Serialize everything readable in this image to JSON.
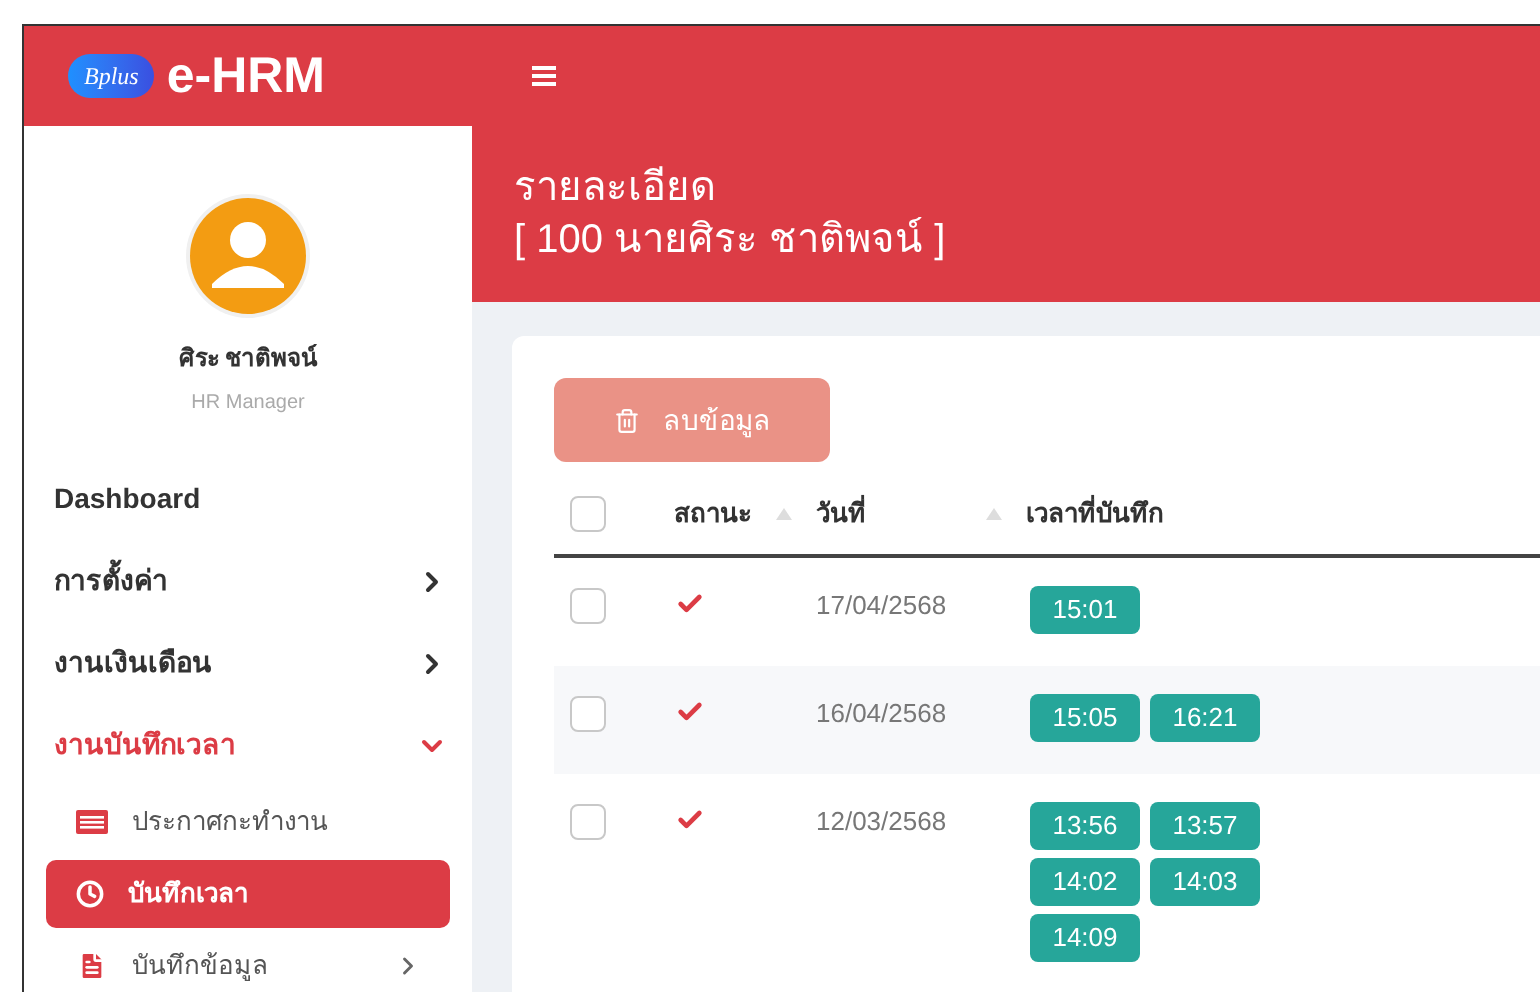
{
  "app": {
    "logo_text": "Bplus",
    "title": "e-HRM"
  },
  "user": {
    "name": "ศิระ ชาติพจน์",
    "role": "HR Manager"
  },
  "menu": [
    {
      "label": "Dashboard",
      "expandable": false,
      "expanded": false
    },
    {
      "label": "การตั้งค่า",
      "expandable": true,
      "expanded": false
    },
    {
      "label": "งานเงินเดือน",
      "expandable": true,
      "expanded": false
    },
    {
      "label": "งานบันทึกเวลา",
      "expandable": true,
      "expanded": true,
      "children": [
        {
          "label": "ประกาศกะทำงาน",
          "kind": "list",
          "selected": false,
          "expandable": false
        },
        {
          "label": "บันทึกเวลา",
          "kind": "clock",
          "selected": true,
          "expandable": false
        },
        {
          "label": "บันทึกข้อมูล",
          "kind": "file",
          "selected": false,
          "expandable": true
        }
      ]
    }
  ],
  "page": {
    "title": "รายละเอียด",
    "subtitle": "[ 100 นายศิระ ชาติพจน์ ]"
  },
  "delete_button": {
    "label": "ลบข้อมูล",
    "disabled": true
  },
  "table": {
    "select_all": {
      "checked": false
    },
    "columns": [
      {
        "label": "สถานะ",
        "sortable": true
      },
      {
        "label": "วันที่",
        "sortable": true
      },
      {
        "label": "เวลาที่บันทึก",
        "sortable": false
      }
    ],
    "rows": [
      {
        "checked": false,
        "done": true,
        "date": "17/04/2568",
        "times": [
          "15:01"
        ]
      },
      {
        "checked": false,
        "done": true,
        "date": "16/04/2568",
        "times": [
          "15:05",
          "16:21"
        ]
      },
      {
        "checked": false,
        "done": true,
        "date": "12/03/2568",
        "times": [
          "13:56",
          "13:57",
          "14:02",
          "14:03",
          "14:09"
        ]
      }
    ]
  }
}
